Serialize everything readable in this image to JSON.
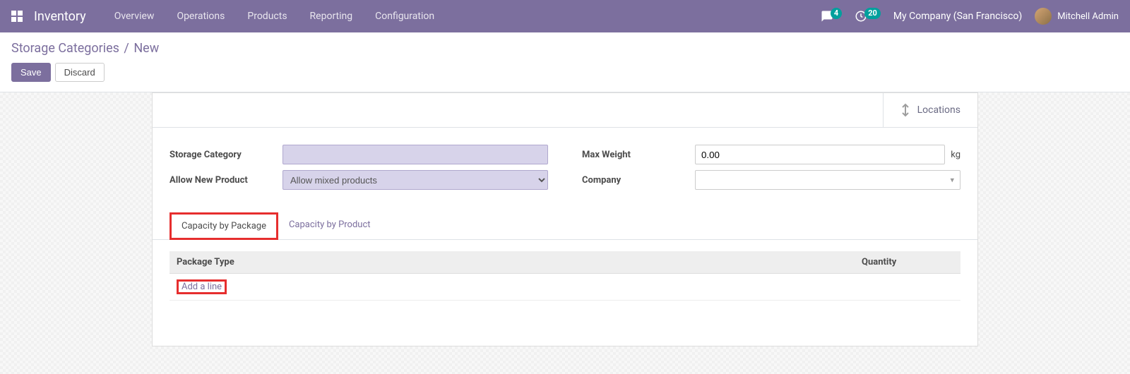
{
  "navbar": {
    "app": "Inventory",
    "menu": [
      "Overview",
      "Operations",
      "Products",
      "Reporting",
      "Configuration"
    ],
    "messages_badge": "4",
    "activities_badge": "20",
    "company": "My Company (San Francisco)",
    "user": "Mitchell Admin"
  },
  "breadcrumb": {
    "parent": "Storage Categories",
    "current": "New"
  },
  "buttons": {
    "save": "Save",
    "discard": "Discard"
  },
  "statusbar": {
    "locations": "Locations"
  },
  "form": {
    "storage_category_label": "Storage Category",
    "storage_category_value": "",
    "allow_new_product_label": "Allow New Product",
    "allow_new_product_value": "Allow mixed products",
    "max_weight_label": "Max Weight",
    "max_weight_value": "0.00",
    "max_weight_unit": "kg",
    "company_label": "Company",
    "company_value": ""
  },
  "tabs": {
    "capacity_by_package": "Capacity by Package",
    "capacity_by_product": "Capacity by Product"
  },
  "table": {
    "col_package_type": "Package Type",
    "col_quantity": "Quantity",
    "add_line": "Add a line"
  }
}
